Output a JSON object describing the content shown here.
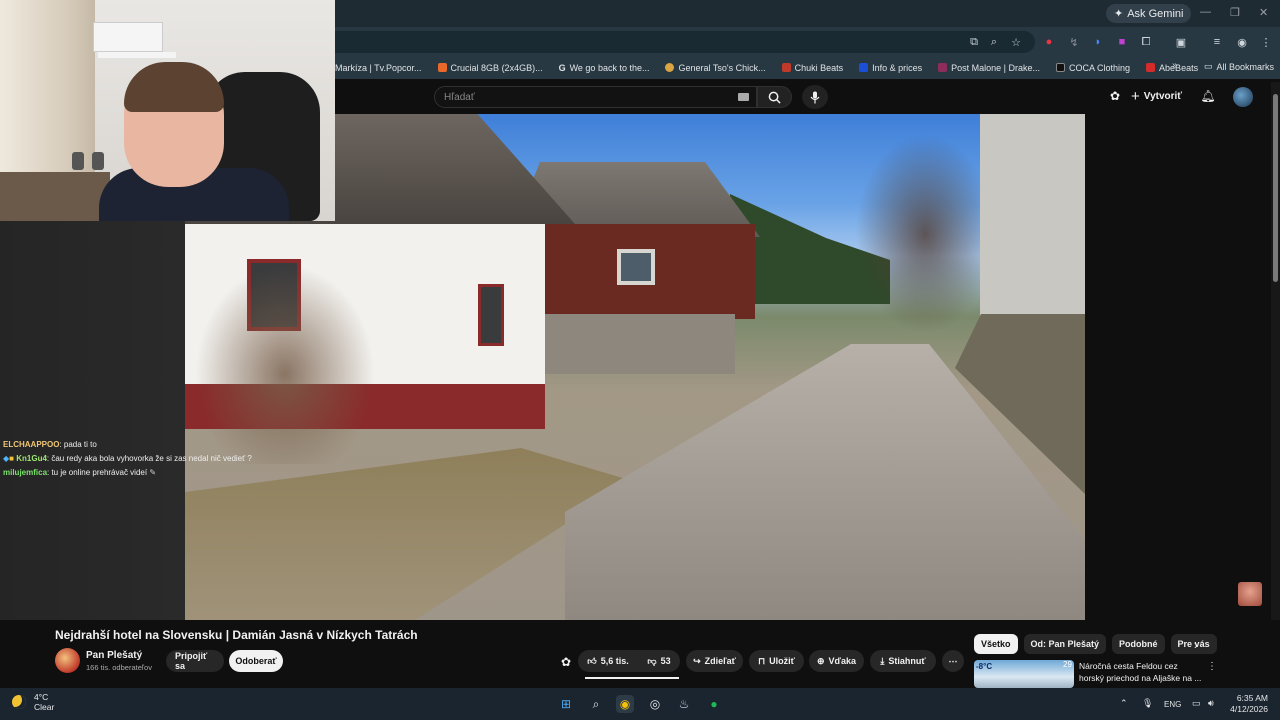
{
  "browser": {
    "ask_gemini": "Ask Gemini",
    "bookmarks": [
      {
        "label": "Markíza | Tv.Popcor...",
        "color": "#6a9ec8"
      },
      {
        "label": "Crucial 8GB (2x4GB)...",
        "color": "#e8692a"
      },
      {
        "label": "We go back to the...",
        "color": "#ffffff"
      },
      {
        "label": "General Tso's Chick...",
        "color": "#d9a441"
      },
      {
        "label": "Chuki Beats",
        "color": "#c0392b"
      },
      {
        "label": "Info & prices",
        "color": "#1a4fd6"
      },
      {
        "label": "Post Malone | Drake...",
        "color": "#8e2d5b"
      },
      {
        "label": "COCA Clothing",
        "color": "#222222"
      },
      {
        "label": "AbeBeats",
        "color": "#d62b2b"
      }
    ],
    "all_bookmarks": "All Bookmarks"
  },
  "youtube": {
    "search_placeholder": "Hľadať",
    "create_label": "Vytvoriť"
  },
  "chat": [
    {
      "user": "ELCHAAPPOO",
      "color": "#f0c674",
      "text": ": pada ti to"
    },
    {
      "user": "Kn1Gu4",
      "color": "#9fe870",
      "text": ": čau redy aka bola vyhovorka že si zas nedal nič vedieť ?"
    },
    {
      "user": "milujemfica",
      "color": "#7be36b",
      "text": ": tu je online prehrávač videí"
    }
  ],
  "video": {
    "title": "Nejdrahší hotel na Slovensku | Damián Jasná v Nízkych Tatrách",
    "channel": "Pan Plešatý",
    "subscribers": "166 tis. odberateľov",
    "join_label": "Pripojiť sa",
    "subscribe_label": "Odoberať",
    "likes": "5,6 tis.",
    "dislikes": "53",
    "share": "Zdieľať",
    "save": "Uložiť",
    "thanks": "Vďaka",
    "download": "Stiahnuť"
  },
  "recommendations": {
    "chips": [
      "Všetko",
      "Od: Pan Plešatý",
      "Podobné",
      "Pre vás"
    ],
    "active_chip": 0,
    "item": {
      "title": "Náročná cesta Feldou cez horský priechod na Aljaške na ...",
      "index": "29",
      "thumb_text": "-8°C"
    }
  },
  "taskbar": {
    "temp": "4°C",
    "condition": "Clear",
    "lang": "ENG",
    "time": "6:35 AM",
    "date": "4/12/2026"
  }
}
